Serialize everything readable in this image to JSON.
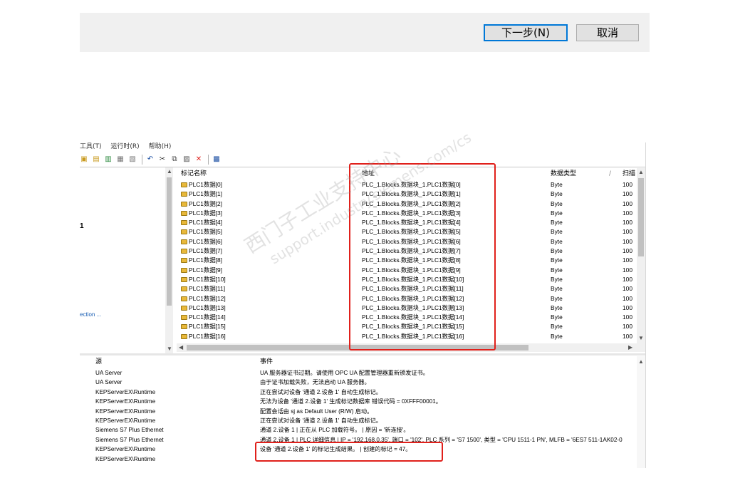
{
  "dialog": {
    "next_label": "下一步(N)",
    "cancel_label": "取消"
  },
  "menu": [
    "工具(T)",
    "运行时(R)",
    "帮助(H)"
  ],
  "toolbar_icons": [
    {
      "name": "new-channel-icon",
      "glyph": "▣",
      "color": "#c99a1e"
    },
    {
      "name": "new-device-icon",
      "glyph": "▤",
      "color": "#c99a1e"
    },
    {
      "name": "new-group-icon",
      "glyph": "▥",
      "color": "#2b8a3e"
    },
    {
      "name": "new-tag-icon",
      "glyph": "▦",
      "color": "#777777"
    },
    {
      "name": "bulk-tag-icon",
      "glyph": "▧",
      "color": "#777777"
    },
    {
      "name": "undo-icon",
      "glyph": "↶",
      "color": "#1c4fa3"
    },
    {
      "name": "cut-icon",
      "glyph": "✂",
      "color": "#333333"
    },
    {
      "name": "copy-icon",
      "glyph": "⧉",
      "color": "#444444"
    },
    {
      "name": "paste-icon",
      "glyph": "▨",
      "color": "#555555"
    },
    {
      "name": "delete-icon",
      "glyph": "✕",
      "color": "#e0201b"
    },
    {
      "name": "quick-client-icon",
      "glyph": "▩",
      "color": "#1c4fa3"
    }
  ],
  "tree": {
    "node_number": "1",
    "connection_label": "ection ..."
  },
  "tags": {
    "headers": {
      "name": "标记名称",
      "address": "地址",
      "type": "数据类型",
      "scan": "扫描"
    },
    "rows": [
      {
        "name": "PLC1数据[0]",
        "address": "PLC_1.Blocks.数据块_1.PLC1数据[0]",
        "type": "Byte",
        "scan": "100"
      },
      {
        "name": "PLC1数据[1]",
        "address": "PLC_1.Blocks.数据块_1.PLC1数据[1]",
        "type": "Byte",
        "scan": "100"
      },
      {
        "name": "PLC1数据[2]",
        "address": "PLC_1.Blocks.数据块_1.PLC1数据[2]",
        "type": "Byte",
        "scan": "100"
      },
      {
        "name": "PLC1数据[3]",
        "address": "PLC_1.Blocks.数据块_1.PLC1数据[3]",
        "type": "Byte",
        "scan": "100"
      },
      {
        "name": "PLC1数据[4]",
        "address": "PLC_1.Blocks.数据块_1.PLC1数据[4]",
        "type": "Byte",
        "scan": "100"
      },
      {
        "name": "PLC1数据[5]",
        "address": "PLC_1.Blocks.数据块_1.PLC1数据[5]",
        "type": "Byte",
        "scan": "100"
      },
      {
        "name": "PLC1数据[6]",
        "address": "PLC_1.Blocks.数据块_1.PLC1数据[6]",
        "type": "Byte",
        "scan": "100"
      },
      {
        "name": "PLC1数据[7]",
        "address": "PLC_1.Blocks.数据块_1.PLC1数据[7]",
        "type": "Byte",
        "scan": "100"
      },
      {
        "name": "PLC1数据[8]",
        "address": "PLC_1.Blocks.数据块_1.PLC1数据[8]",
        "type": "Byte",
        "scan": "100"
      },
      {
        "name": "PLC1数据[9]",
        "address": "PLC_1.Blocks.数据块_1.PLC1数据[9]",
        "type": "Byte",
        "scan": "100"
      },
      {
        "name": "PLC1数据[10]",
        "address": "PLC_1.Blocks.数据块_1.PLC1数据[10]",
        "type": "Byte",
        "scan": "100"
      },
      {
        "name": "PLC1数据[11]",
        "address": "PLC_1.Blocks.数据块_1.PLC1数据[11]",
        "type": "Byte",
        "scan": "100"
      },
      {
        "name": "PLC1数据[12]",
        "address": "PLC_1.Blocks.数据块_1.PLC1数据[12]",
        "type": "Byte",
        "scan": "100"
      },
      {
        "name": "PLC1数据[13]",
        "address": "PLC_1.Blocks.数据块_1.PLC1数据[13]",
        "type": "Byte",
        "scan": "100"
      },
      {
        "name": "PLC1数据[14]",
        "address": "PLC_1.Blocks.数据块_1.PLC1数据[14]",
        "type": "Byte",
        "scan": "100"
      },
      {
        "name": "PLC1数据[15]",
        "address": "PLC_1.Blocks.数据块_1.PLC1数据[15]",
        "type": "Byte",
        "scan": "100"
      },
      {
        "name": "PLC1数据[16]",
        "address": "PLC_1.Blocks.数据块_1.PLC1数据[16]",
        "type": "Byte",
        "scan": "100"
      }
    ]
  },
  "log": {
    "headers": {
      "source": "源",
      "event": "事件"
    },
    "rows": [
      {
        "source": "UA Server",
        "event": "UA 服务器证书过期。请使用 OPC UA 配置管理器重新颁发证书。"
      },
      {
        "source": "UA Server",
        "event": "由于证书加载失败，无法启动 UA 服务器。"
      },
      {
        "source": "KEPServerEX\\Runtime",
        "event": "正在尝试对设备 '通道 2.设备 1' 自动生成标记。"
      },
      {
        "source": "KEPServerEX\\Runtime",
        "event": "无法为设备 '通道 2.设备 1' 生成标记数据库 错误代码 = 0XFFF00001。"
      },
      {
        "source": "KEPServerEX\\Runtime",
        "event": "配置会话由 sj as Default User (R/W) 启动。"
      },
      {
        "source": "KEPServerEX\\Runtime",
        "event": "正在尝试对设备 '通道 2.设备 1' 自动生成标记。"
      },
      {
        "source": "Siemens S7 Plus Ethernet",
        "event": "通道 2.设备 1 | 正在从 PLC 加载符号。 | 原因 = '新连接'。"
      },
      {
        "source": "Siemens S7 Plus Ethernet",
        "event": "通道 2.设备 1 | PLC 详细信息 | IP = '192.168.0.35', 端口 = '102', PLC 系列 = 'S7 1500', 类型 = 'CPU 1511-1 PN', MLFB = '6ES7 511-1AK02-0"
      },
      {
        "source": "KEPServerEX\\Runtime",
        "event": "设备 '通道 2.设备 1' 的标记生成结果。 | 创建的标记 = 47。"
      },
      {
        "source": "KEPServerEX\\Runtime",
        "event": ""
      }
    ]
  },
  "watermark": {
    "line1": "西门子工业支持中心",
    "line2": "support.industry.siemens.com/cs"
  }
}
